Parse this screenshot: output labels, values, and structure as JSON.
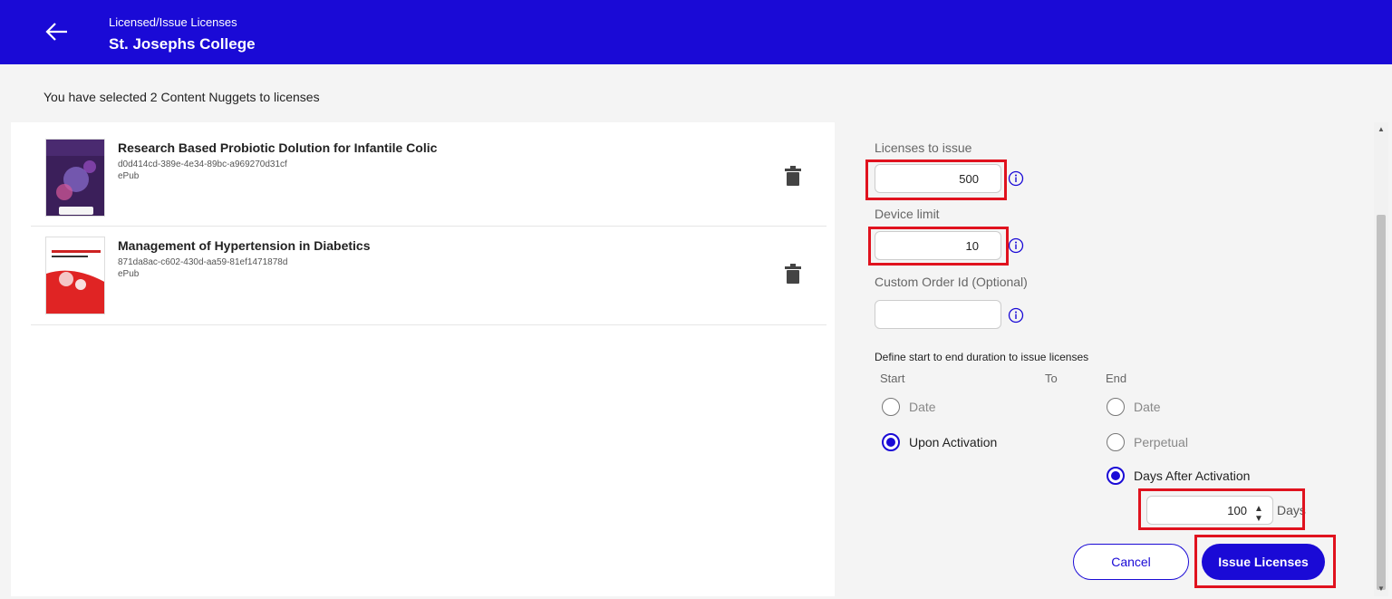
{
  "colors": {
    "brand": "#1a0ad6",
    "highlight": "#e0121e",
    "panel": "#f4f4f4"
  },
  "header": {
    "breadcrumb": "Licensed/Issue Licenses",
    "title": "St. Josephs College",
    "back_icon": "arrow-left-icon"
  },
  "selection_message": "You have selected 2 Content Nuggets to licenses",
  "items": [
    {
      "title": "Research Based Probiotic Dolution for Infantile Colic",
      "id": "d0d414cd-389e-4e34-89bc-a969270d31cf",
      "type": "ePub",
      "delete_icon": "trash-icon"
    },
    {
      "title": "Management of Hypertension in Diabetics",
      "id": "871da8ac-c602-430d-aa59-81ef1471878d",
      "type": "ePub",
      "delete_icon": "trash-icon"
    }
  ],
  "form": {
    "licenses": {
      "label": "Licenses to issue",
      "value": "500"
    },
    "device_limit": {
      "label": "Device limit",
      "value": "10"
    },
    "custom_order": {
      "label": "Custom Order Id (Optional)",
      "value": ""
    },
    "duration": {
      "label": "Define start to end duration to issue licenses",
      "start_label": "Start",
      "to_label": "To",
      "end_label": "End",
      "start_options": [
        {
          "label": "Date",
          "selected": false
        },
        {
          "label": "Upon Activation",
          "selected": true
        }
      ],
      "end_options": [
        {
          "label": "Date",
          "selected": false
        },
        {
          "label": "Perpetual",
          "selected": false
        },
        {
          "label": "Days After Activation",
          "selected": true
        }
      ],
      "days_value": "100",
      "days_unit": "Days"
    }
  },
  "actions": {
    "cancel": "Cancel",
    "issue": "Issue Licenses"
  }
}
